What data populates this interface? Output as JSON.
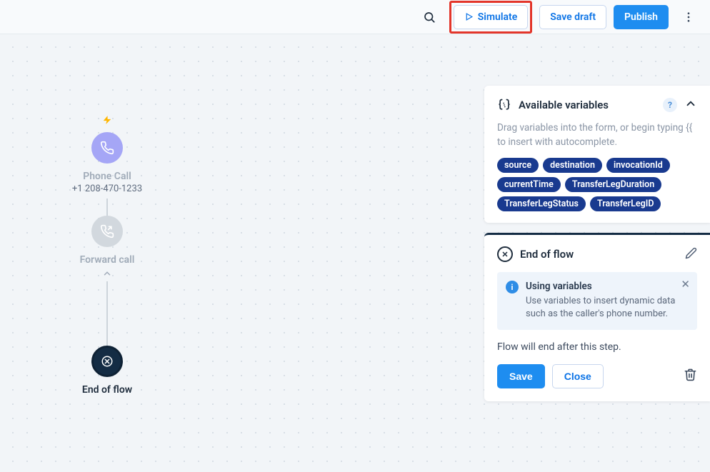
{
  "header": {
    "simulate": "Simulate",
    "save_draft": "Save draft",
    "publish": "Publish"
  },
  "flow": {
    "node1": {
      "title": "Phone Call",
      "subtitle": "+1 208-470-1233"
    },
    "node2": {
      "title": "Forward call"
    },
    "node3": {
      "title": "End of flow"
    }
  },
  "variables_panel": {
    "title": "Available variables",
    "description": "Drag variables into the form, or begin typing {{ to insert with autocomplete.",
    "chips": [
      "source",
      "destination",
      "invocationId",
      "currentTime",
      "TransferLegDuration",
      "TransferLegStatus",
      "TransferLegID"
    ]
  },
  "end_panel": {
    "title": "End of flow",
    "info_title": "Using variables",
    "info_text": "Use variables to insert dynamic data such as the caller's phone number.",
    "message": "Flow will end after this step.",
    "save": "Save",
    "close": "Close"
  }
}
